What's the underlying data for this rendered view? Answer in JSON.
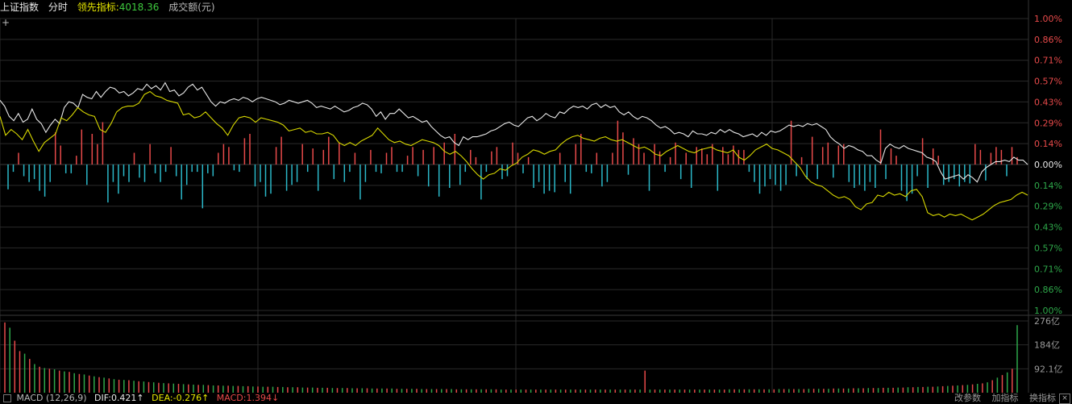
{
  "header": {
    "index_name": "上证指数",
    "mode": "分时",
    "leading_label": "领先指标",
    "leading_value": "4018.36",
    "volume_label": "成交额(元)"
  },
  "footer": {
    "macd_label": "MACD (12,26,9)",
    "dif": "DIF:0.421↑",
    "dea": "DEA:-0.276↑",
    "macd": "MACD:1.394↓",
    "tools": [
      "改参数",
      "加指标",
      "换指标"
    ]
  },
  "colors": {
    "background": "#000000",
    "grid": "#2a2a2a",
    "price_line": "#e8e8e8",
    "leading_line": "#d8d800",
    "up": "#e84a4a",
    "down": "#2bb8c8",
    "vol_up": "#e84a4a",
    "vol_down": "#2ea84a",
    "neutral_label": "#e8e8e8"
  },
  "chart_data": {
    "type": "line",
    "y_labels_up": [
      "1.00%",
      "0.86%",
      "0.71%",
      "0.57%",
      "0.43%",
      "0.29%",
      "0.14%"
    ],
    "y_label_zero": "0.00%",
    "y_labels_down": [
      "0.14%",
      "0.29%",
      "0.43%",
      "0.57%",
      "0.71%",
      "0.86%",
      "1.00%"
    ],
    "ylim": [
      -1.0,
      1.0
    ],
    "volume_labels": [
      "276亿",
      "184亿",
      "92.1亿"
    ],
    "volume_ylim": [
      0,
      276
    ],
    "series": [
      {
        "name": "上证指数",
        "color": "#e8e8e8",
        "values": [
          0.44,
          0.4,
          0.33,
          0.3,
          0.35,
          0.29,
          0.31,
          0.38,
          0.31,
          0.28,
          0.22,
          0.27,
          0.31,
          0.28,
          0.39,
          0.43,
          0.42,
          0.39,
          0.48,
          0.46,
          0.45,
          0.5,
          0.46,
          0.5,
          0.53,
          0.52,
          0.49,
          0.5,
          0.47,
          0.49,
          0.52,
          0.51,
          0.55,
          0.52,
          0.54,
          0.51,
          0.56,
          0.5,
          0.51,
          0.47,
          0.49,
          0.53,
          0.55,
          0.51,
          0.53,
          0.48,
          0.43,
          0.4,
          0.43,
          0.42,
          0.44,
          0.45,
          0.44,
          0.46,
          0.45,
          0.43,
          0.45,
          0.46,
          0.45,
          0.44,
          0.43,
          0.41,
          0.42,
          0.44,
          0.43,
          0.42,
          0.43,
          0.44,
          0.42,
          0.39,
          0.4,
          0.39,
          0.38,
          0.4,
          0.38,
          0.36,
          0.37,
          0.39,
          0.4,
          0.42,
          0.41,
          0.38,
          0.33,
          0.36,
          0.31,
          0.35,
          0.35,
          0.38,
          0.35,
          0.32,
          0.33,
          0.31,
          0.29,
          0.3,
          0.26,
          0.23,
          0.2,
          0.18,
          0.19,
          0.15,
          0.13,
          0.19,
          0.17,
          0.19,
          0.19,
          0.2,
          0.21,
          0.23,
          0.24,
          0.26,
          0.28,
          0.29,
          0.27,
          0.26,
          0.29,
          0.32,
          0.33,
          0.3,
          0.32,
          0.35,
          0.33,
          0.32,
          0.36,
          0.35,
          0.38,
          0.4,
          0.39,
          0.4,
          0.38,
          0.41,
          0.42,
          0.39,
          0.41,
          0.39,
          0.4,
          0.36,
          0.34,
          0.36,
          0.33,
          0.31,
          0.33,
          0.32,
          0.3,
          0.27,
          0.25,
          0.26,
          0.24,
          0.21,
          0.22,
          0.21,
          0.19,
          0.23,
          0.21,
          0.21,
          0.2,
          0.22,
          0.21,
          0.24,
          0.22,
          0.24,
          0.22,
          0.21,
          0.19,
          0.2,
          0.21,
          0.19,
          0.22,
          0.2,
          0.23,
          0.22,
          0.23,
          0.25,
          0.27,
          0.26,
          0.27,
          0.26,
          0.28,
          0.27,
          0.28,
          0.26,
          0.24,
          0.19,
          0.16,
          0.14,
          0.11,
          0.13,
          0.12,
          0.1,
          0.09,
          0.06,
          0.06,
          0.03,
          0.01,
          0.11,
          0.14,
          0.12,
          0.11,
          0.13,
          0.11,
          0.1,
          0.09,
          0.08,
          0.05,
          0.04,
          0.02,
          -0.05,
          -0.1,
          -0.09,
          -0.08,
          -0.07,
          -0.1,
          -0.07,
          -0.09,
          -0.12,
          -0.05,
          -0.02,
          0.0,
          0.02,
          0.02,
          0.03,
          0.02,
          0.05,
          0.03,
          0.03,
          0.0
        ]
      },
      {
        "name": "领先指标",
        "color": "#d8d800",
        "values": [
          0.33,
          0.2,
          0.24,
          0.21,
          0.17,
          0.24,
          0.16,
          0.09,
          0.15,
          0.18,
          0.21,
          0.32,
          0.3,
          0.34,
          0.39,
          0.36,
          0.34,
          0.33,
          0.24,
          0.22,
          0.28,
          0.36,
          0.39,
          0.4,
          0.4,
          0.42,
          0.48,
          0.5,
          0.47,
          0.46,
          0.44,
          0.43,
          0.42,
          0.34,
          0.35,
          0.32,
          0.33,
          0.36,
          0.32,
          0.28,
          0.25,
          0.2,
          0.27,
          0.32,
          0.33,
          0.32,
          0.29,
          0.32,
          0.31,
          0.3,
          0.29,
          0.27,
          0.23,
          0.24,
          0.25,
          0.22,
          0.23,
          0.21,
          0.21,
          0.22,
          0.2,
          0.15,
          0.13,
          0.15,
          0.13,
          0.16,
          0.18,
          0.2,
          0.25,
          0.21,
          0.17,
          0.15,
          0.16,
          0.14,
          0.13,
          0.15,
          0.17,
          0.16,
          0.15,
          0.13,
          0.09,
          0.07,
          0.09,
          0.06,
          0.02,
          -0.03,
          -0.07,
          -0.1,
          -0.07,
          -0.06,
          -0.03,
          -0.04,
          -0.01,
          0.01,
          0.05,
          0.07,
          0.1,
          0.09,
          0.07,
          0.09,
          0.1,
          0.14,
          0.17,
          0.19,
          0.2,
          0.18,
          0.17,
          0.16,
          0.18,
          0.19,
          0.17,
          0.16,
          0.17,
          0.15,
          0.13,
          0.11,
          0.12,
          0.1,
          0.07,
          0.06,
          0.09,
          0.11,
          0.13,
          0.11,
          0.09,
          0.08,
          0.1,
          0.11,
          0.12,
          0.1,
          0.09,
          0.08,
          0.1,
          0.05,
          0.03,
          0.06,
          0.1,
          0.12,
          0.14,
          0.11,
          0.1,
          0.08,
          0.06,
          0.02,
          -0.02,
          -0.08,
          -0.12,
          -0.14,
          -0.15,
          -0.18,
          -0.21,
          -0.23,
          -0.22,
          -0.24,
          -0.29,
          -0.31,
          -0.27,
          -0.26,
          -0.21,
          -0.22,
          -0.19,
          -0.21,
          -0.2,
          -0.22,
          -0.18,
          -0.17,
          -0.22,
          -0.33,
          -0.35,
          -0.34,
          -0.36,
          -0.34,
          -0.35,
          -0.34,
          -0.36,
          -0.38,
          -0.36,
          -0.34,
          -0.31,
          -0.28,
          -0.26,
          -0.25,
          -0.24,
          -0.21,
          -0.19,
          -0.21
        ]
      }
    ],
    "macd_bars": [
      -0.17,
      -0.05,
      0.08,
      -0.08,
      -0.12,
      -0.1,
      -0.18,
      -0.22,
      -0.12,
      0.22,
      0.13,
      -0.06,
      -0.06,
      0.06,
      0.24,
      -0.14,
      0.21,
      0.14,
      0.29,
      -0.26,
      -0.12,
      -0.2,
      -0.08,
      -0.12,
      0.08,
      -0.09,
      -0.12,
      0.14,
      -0.06,
      -0.12,
      -0.05,
      0.12,
      -0.08,
      -0.24,
      -0.14,
      -0.05,
      -0.05,
      -0.3,
      -0.06,
      -0.08,
      0.08,
      0.14,
      0.12,
      -0.04,
      -0.05,
      0.18,
      0.21,
      -0.15,
      -0.12,
      -0.22,
      -0.2,
      0.12,
      0.19,
      -0.18,
      -0.14,
      -0.12,
      0.14,
      -0.05,
      0.11,
      -0.18,
      0.1,
      0.19,
      -0.1,
      0.15,
      -0.12,
      -0.05,
      0.08,
      -0.24,
      -0.12,
      0.1,
      -0.05,
      -0.06,
      0.08,
      0.12,
      -0.05,
      -0.05,
      0.06,
      0.12,
      -0.08,
      0.1,
      -0.15,
      0.12,
      -0.22,
      0.15,
      -0.16,
      0.21,
      -0.14,
      -0.05,
      0.1,
      0.05,
      -0.24,
      -0.05,
      0.09,
      0.12,
      -0.1,
      -0.08,
      0.15,
      0.08,
      -0.06,
      0.05,
      -0.16,
      -0.12,
      -0.2,
      -0.18,
      -0.19,
      0.08,
      -0.12,
      -0.2,
      0.14,
      0.21,
      -0.05,
      -0.06,
      0.08,
      -0.15,
      -0.12,
      0.08,
      0.3,
      0.22,
      -0.07,
      0.18,
      0.14,
      0.08,
      -0.18,
      0.14,
      0.09,
      -0.05,
      0.05,
      0.15,
      -0.1,
      0.08,
      -0.16,
      0.12,
      0.11,
      0.07,
      0.14,
      -0.18,
      0.12,
      0.07,
      0.13,
      0.1,
      0.1,
      -0.05,
      -0.12,
      -0.2,
      -0.15,
      -0.1,
      -0.14,
      -0.18,
      -0.14,
      0.3,
      -0.08,
      0.05,
      -0.1,
      0.19,
      -0.1,
      0.12,
      0.15,
      -0.09,
      0.13,
      0.14,
      -0.12,
      -0.16,
      -0.14,
      -0.18,
      -0.12,
      -0.16,
      0.24,
      -0.1,
      0.11,
      0.06,
      -0.18,
      -0.25,
      -0.2,
      -0.08,
      0.18,
      -0.16,
      0.11,
      0.06,
      -0.14,
      -0.12,
      -0.1,
      -0.15,
      -0.12,
      -0.13,
      0.14,
      0.1,
      -0.11,
      0.08,
      0.12,
      0.1,
      -0.08,
      0.12,
      0.05
    ],
    "volume_up_flags": [
      1,
      0,
      1,
      1,
      0,
      1,
      0,
      1,
      0,
      1,
      0,
      1,
      0,
      1,
      0,
      1,
      0,
      1,
      0,
      1,
      0,
      1,
      0,
      1,
      0,
      1,
      0,
      1,
      0,
      1,
      0,
      1,
      0,
      1,
      0,
      1,
      0,
      1,
      0,
      1,
      0,
      1,
      0,
      1,
      0,
      1,
      0,
      1,
      0,
      1,
      0,
      1,
      0,
      1,
      0,
      1,
      0,
      1,
      0,
      1,
      0,
      1,
      0,
      1,
      0,
      1,
      0,
      1,
      0,
      1,
      0,
      1,
      0,
      1,
      0,
      1,
      0,
      1,
      0,
      1,
      0,
      1,
      0,
      1,
      0,
      1,
      0,
      1,
      0,
      1,
      0,
      1,
      0,
      1,
      0,
      1,
      0,
      1,
      0,
      1,
      0,
      1,
      0,
      1,
      0,
      1,
      0,
      1,
      0,
      1,
      0,
      1,
      0,
      1,
      0,
      1,
      0,
      1,
      0,
      1,
      0,
      1,
      0,
      1,
      0,
      1,
      0,
      1,
      0,
      1,
      0,
      1,
      0,
      1,
      0,
      1,
      0,
      1,
      0,
      1,
      0,
      1,
      0,
      1,
      0,
      1,
      0,
      1,
      0,
      1,
      0,
      1,
      0,
      1,
      0,
      1,
      0,
      1,
      0,
      1,
      0,
      1,
      0,
      1,
      0,
      1,
      0,
      1,
      0,
      1,
      0,
      1,
      0,
      1,
      0,
      1,
      0,
      1,
      0,
      1,
      0,
      1,
      0,
      1,
      0,
      1,
      0,
      1,
      0,
      1,
      0,
      1,
      0,
      1,
      0,
      1,
      0,
      1,
      0,
      1,
      0,
      1,
      0,
      1,
      0,
      1,
      0,
      1
    ],
    "volume_values": [
      270,
      250,
      200,
      160,
      150,
      130,
      110,
      100,
      95,
      92,
      90,
      85,
      82,
      80,
      75,
      72,
      70,
      66,
      63,
      60,
      58,
      55,
      52,
      50,
      49,
      48,
      46,
      44,
      43,
      41,
      40,
      38,
      37,
      36,
      35,
      34,
      33,
      32,
      31,
      30,
      30,
      29,
      28,
      28,
      27,
      27,
      26,
      26,
      25,
      25,
      24,
      24,
      23,
      23,
      23,
      22,
      22,
      21,
      21,
      21,
      20,
      20,
      20,
      19,
      19,
      19,
      18,
      18,
      18,
      18,
      17,
      17,
      17,
      17,
      16,
      16,
      16,
      16,
      16,
      15,
      15,
      15,
      15,
      15,
      14,
      14,
      14,
      14,
      14,
      14,
      14,
      13,
      13,
      13,
      13,
      13,
      13,
      13,
      13,
      13,
      12,
      12,
      12,
      12,
      12,
      12,
      12,
      12,
      12,
      12,
      12,
      12,
      12,
      12,
      12,
      12,
      12,
      12,
      12,
      12,
      12,
      12,
      12,
      12,
      12,
      12,
      12,
      12,
      12,
      85,
      12,
      12,
      12,
      12,
      12,
      12,
      12,
      12,
      12,
      12,
      12,
      12,
      12,
      12,
      12,
      12,
      13,
      13,
      13,
      13,
      13,
      13,
      13,
      13,
      13,
      13,
      14,
      14,
      14,
      14,
      14,
      14,
      15,
      15,
      15,
      15,
      15,
      16,
      16,
      16,
      16,
      17,
      17,
      17,
      18,
      18,
      18,
      19,
      19,
      19,
      20,
      20,
      21,
      21,
      22,
      22,
      23,
      23,
      24,
      25,
      26,
      27,
      28,
      29,
      30,
      32,
      34,
      36,
      40,
      48,
      58,
      68,
      78,
      92,
      260
    ]
  }
}
